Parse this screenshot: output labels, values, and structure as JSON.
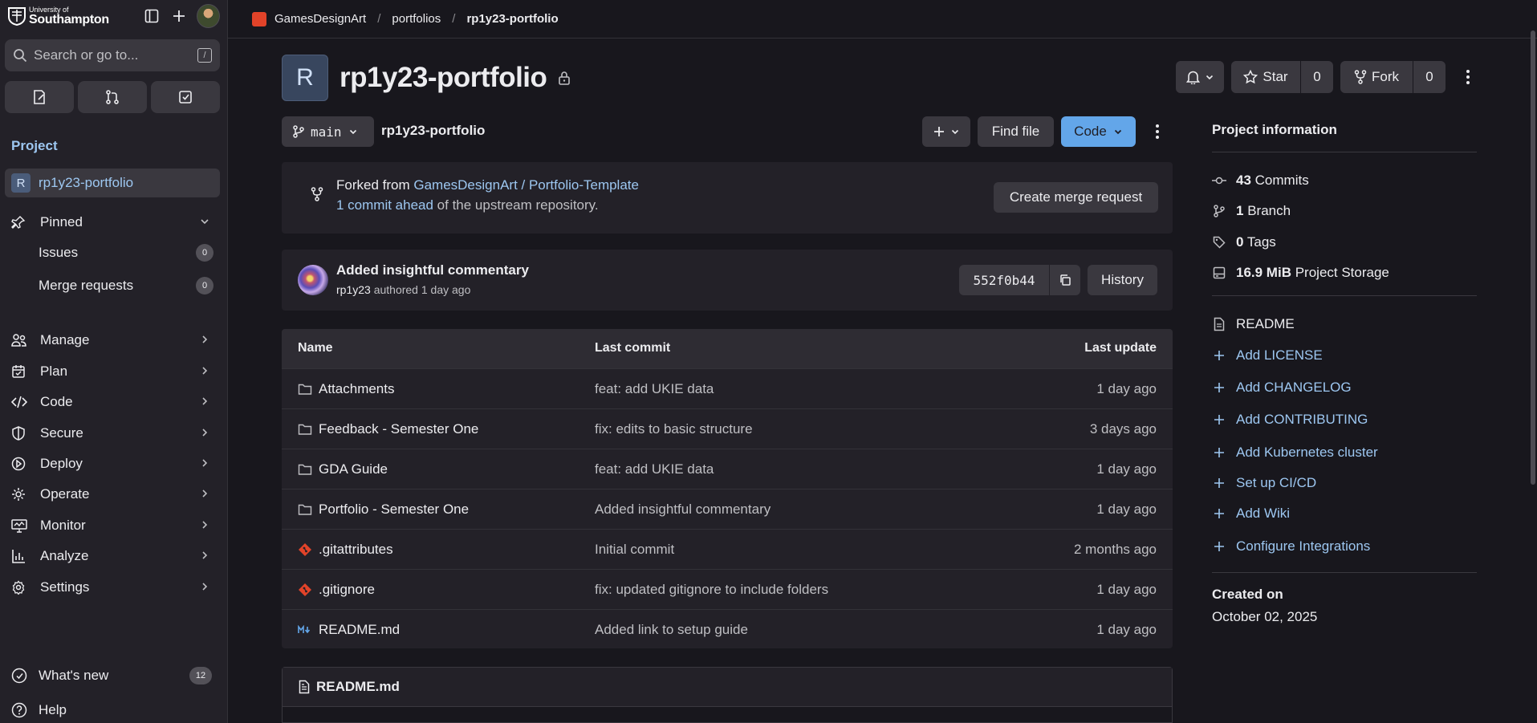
{
  "sidebar": {
    "logo_small": "University of",
    "logo_big": "Southampton",
    "search_placeholder": "Search or go to...",
    "search_shortcut": "/",
    "section_label": "Project",
    "project_name": "rp1y23-portfolio",
    "project_initial": "R",
    "pinned": {
      "label": "Pinned",
      "items": [
        {
          "label": "Issues",
          "count": "0"
        },
        {
          "label": "Merge requests",
          "count": "0"
        }
      ]
    },
    "nav": [
      {
        "label": "Manage",
        "icon": "users-icon"
      },
      {
        "label": "Plan",
        "icon": "calendar-icon"
      },
      {
        "label": "Code",
        "icon": "code-icon"
      },
      {
        "label": "Secure",
        "icon": "shield-icon"
      },
      {
        "label": "Deploy",
        "icon": "rocket-icon"
      },
      {
        "label": "Operate",
        "icon": "cloud-icon"
      },
      {
        "label": "Monitor",
        "icon": "monitor-icon"
      },
      {
        "label": "Analyze",
        "icon": "chart-icon"
      },
      {
        "label": "Settings",
        "icon": "gear-icon"
      }
    ],
    "whats_new": {
      "label": "What's new",
      "count": "12"
    },
    "help": "Help"
  },
  "breadcrumb": [
    "GamesDesignArt",
    "portfolios",
    "rp1y23-portfolio"
  ],
  "project": {
    "initial": "R",
    "title": "rp1y23-portfolio",
    "star_label": "Star",
    "star_count": "0",
    "fork_label": "Fork",
    "fork_count": "0"
  },
  "toolbar": {
    "branch": "main",
    "path": "rp1y23-portfolio",
    "find_file": "Find file",
    "code": "Code"
  },
  "fork_info": {
    "prefix": "Forked from ",
    "source": "GamesDesignArt / Portfolio-Template",
    "ahead_link": "1 commit ahead",
    "ahead_suffix": " of the upstream repository.",
    "merge_button": "Create merge request"
  },
  "last_commit": {
    "message": "Added insightful commentary",
    "author": "rp1y23",
    "meta": " authored 1 day ago",
    "sha": "552f0b44",
    "history": "History"
  },
  "files": {
    "headers": {
      "name": "Name",
      "commit": "Last commit",
      "update": "Last update"
    },
    "rows": [
      {
        "name": "Attachments",
        "type": "folder",
        "commit": "feat: add UKIE data",
        "update": "1 day ago"
      },
      {
        "name": "Feedback - Semester One",
        "type": "folder",
        "commit": "fix: edits to basic structure",
        "update": "3 days ago"
      },
      {
        "name": "GDA Guide",
        "type": "folder",
        "commit": "feat: add UKIE data",
        "update": "1 day ago"
      },
      {
        "name": "Portfolio - Semester One",
        "type": "folder",
        "commit": "Added insightful commentary",
        "update": "1 day ago"
      },
      {
        "name": ".gitattributes",
        "type": "git",
        "commit": "Initial commit",
        "update": "2 months ago"
      },
      {
        "name": ".gitignore",
        "type": "git",
        "commit": "fix: updated gitignore to include folders",
        "update": "1 day ago"
      },
      {
        "name": "README.md",
        "type": "markdown",
        "commit": "Added link to setup guide",
        "update": "1 day ago"
      }
    ]
  },
  "readme": {
    "title": "README.md"
  },
  "info": {
    "heading": "Project information",
    "commits_count": "43",
    "commits_label": " Commits",
    "branch_count": "1",
    "branch_label": " Branch",
    "tags_count": "0",
    "tags_label": " Tags",
    "storage_size": "16.9 MiB",
    "storage_label": " Project Storage",
    "readme": "README",
    "add_links": [
      "Add LICENSE",
      "Add CHANGELOG",
      "Add CONTRIBUTING",
      "Add Kubernetes cluster",
      "Set up CI/CD",
      "Add Wiki",
      "Configure Integrations"
    ],
    "created_label": "Created on",
    "created_date": "October 02, 2025"
  },
  "colors": {
    "background": "#18171d",
    "sidebar": "#232128",
    "link": "#9dc7f1",
    "primary": "#63a6e9",
    "git_icon": "#e24329"
  }
}
